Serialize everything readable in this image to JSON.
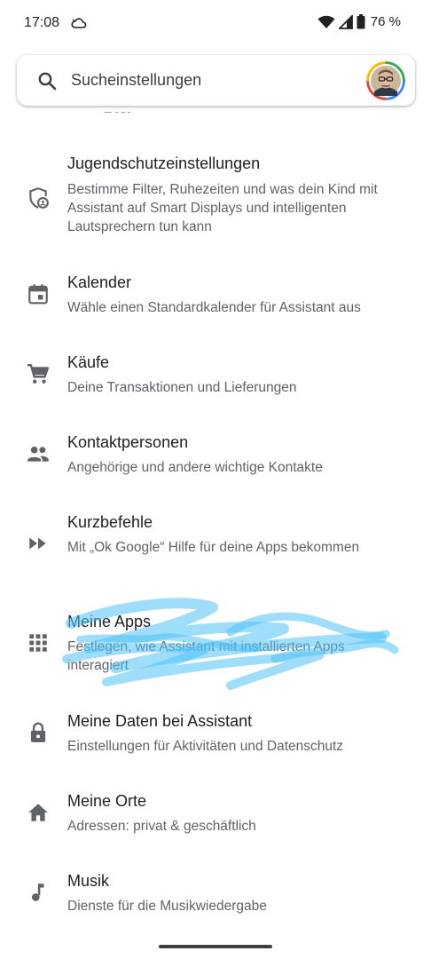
{
  "status_bar": {
    "time": "17:08",
    "battery": "76 %"
  },
  "search": {
    "placeholder": "Sucheinstellungen"
  },
  "items": [
    {
      "title": "Jugendschutzeinstellungen",
      "subtitle": "Bestimme Filter, Ruhezeiten und was dein Kind mit Assistant auf Smart Displays und intelligenten Lautsprechern tun kann",
      "icon": "shield-child-icon"
    },
    {
      "title": "Kalender",
      "subtitle": "Wähle einen Standardkalender für Assistant aus",
      "icon": "calendar-icon"
    },
    {
      "title": "Käufe",
      "subtitle": "Deine Transaktionen und Lieferungen",
      "icon": "cart-icon"
    },
    {
      "title": "Kontaktpersonen",
      "subtitle": "Angehörige und andere wichtige Kontakte",
      "icon": "people-icon"
    },
    {
      "title": "Kurzbefehle",
      "subtitle": "Mit „Ok Google“ Hilfe für deine Apps bekommen",
      "icon": "fast-forward-icon"
    },
    {
      "title": "Meine Apps",
      "subtitle": "Festlegen, wie Assistant mit installierten Apps interagiert",
      "icon": "apps-grid-icon"
    },
    {
      "title": "Meine Daten bei Assistant",
      "subtitle": "Einstellungen für Aktivitäten und Datenschutz",
      "icon": "lock-icon"
    },
    {
      "title": "Meine Orte",
      "subtitle": "Adressen: privat & geschäftlich",
      "icon": "home-icon"
    },
    {
      "title": "Musik",
      "subtitle": "Dienste für die Musikwiedergabe",
      "icon": "music-note-icon"
    }
  ],
  "colors": {
    "icon": "#5f6368",
    "title": "#202124",
    "subtitle": "#5f6368",
    "scribble": "#4fc3f7"
  }
}
